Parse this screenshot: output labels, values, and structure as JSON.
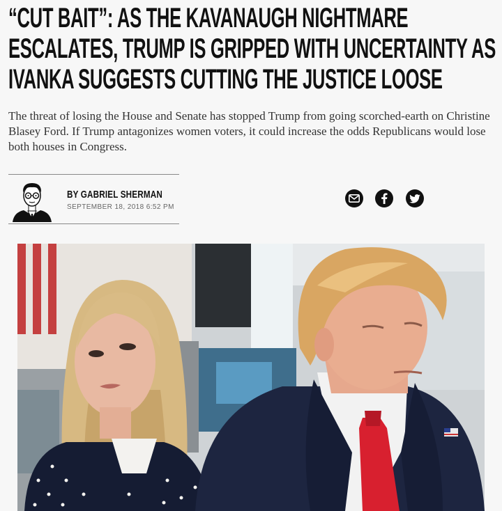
{
  "article": {
    "headline_lines": [
      "“Cut Bait”: As the Kavanaugh Nightmare",
      "Escalates, Trump Is Gripped With Uncertainty As",
      "Ivanka Suggests Cutting the Justice Loose"
    ],
    "dek": "The threat of losing the House and Senate has stopped Trump from going scorched-earth on Christine Blasey Ford. If Trump antagonizes women voters, it could increase the odds Republicans would lose both houses in Congress.",
    "byline": "BY GABRIEL SHERMAN",
    "date": "SEPTEMBER 18, 2018 6:52 PM"
  },
  "share": {
    "icons": [
      "email-icon",
      "facebook-icon",
      "twitter-icon"
    ]
  },
  "colors": {
    "background": "#f7f7f7",
    "text": "#111111",
    "tie_red": "#d8202f",
    "suit_navy": "#1d2540"
  }
}
